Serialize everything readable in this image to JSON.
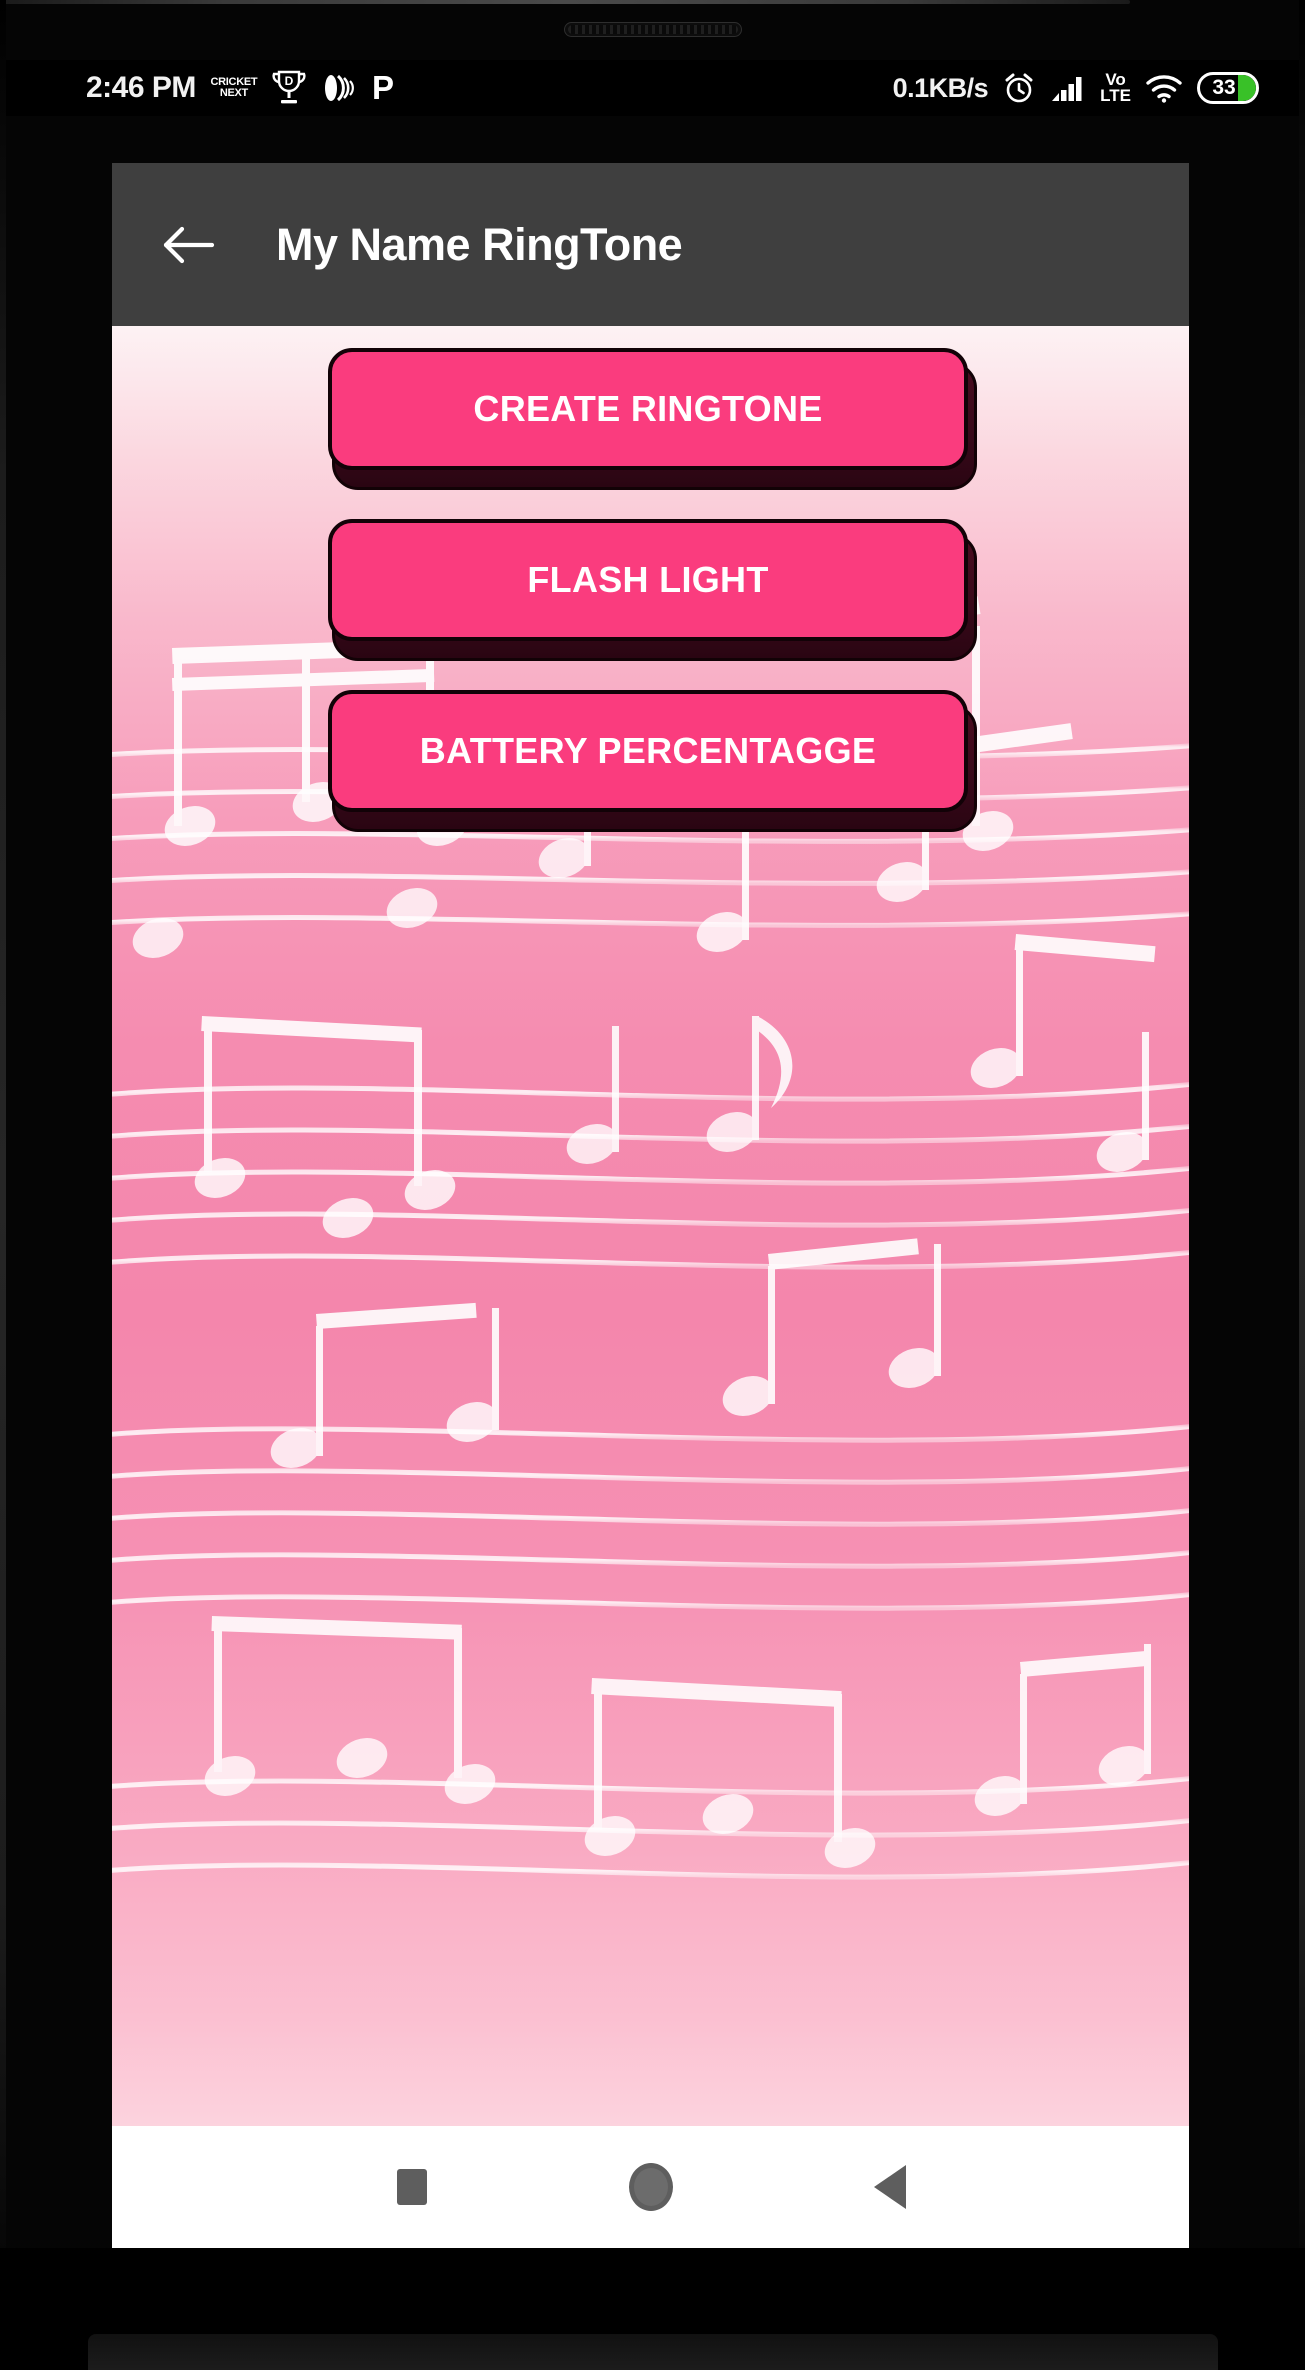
{
  "device": {
    "earpiece_icon": "speaker-grille-icon"
  },
  "status_bar": {
    "clock": "2:46 PM",
    "network_speed": "0.1KB/s",
    "battery_percent": "33",
    "battery_level_pct": 33,
    "network_label_top": "Vo",
    "network_label_bottom": "LTE",
    "notification_icons": [
      {
        "name": "cricket-next-icon",
        "line1": "CRICKET",
        "line2": "NEXT"
      },
      {
        "name": "trophy-d-icon",
        "label": "D"
      },
      {
        "name": "sound-waves-icon",
        "label": ""
      },
      {
        "name": "p-app-icon",
        "label": "P"
      }
    ],
    "right_icons": [
      {
        "name": "alarm-clock-icon"
      },
      {
        "name": "signal-bars-icon"
      },
      {
        "name": "volte-icon"
      },
      {
        "name": "wifi-icon"
      },
      {
        "name": "battery-icon"
      }
    ]
  },
  "app_bar": {
    "back_icon": "back-arrow-icon",
    "title": "My Name RingTone",
    "background_color": "#3f3f3f"
  },
  "main": {
    "background_theme": "pink-music-notes",
    "accent_color": "#fa3c7e",
    "buttons": [
      {
        "name": "create-ringtone-button",
        "label": "CREATE RINGTONE"
      },
      {
        "name": "flash-light-button",
        "label": "FLASH LIGHT"
      },
      {
        "name": "battery-percentage-button",
        "label": "BATTERY PERCENTAGGE"
      }
    ]
  },
  "nav_bar": {
    "items": [
      {
        "name": "nav-recents-button",
        "icon": "square-icon"
      },
      {
        "name": "nav-home-button",
        "icon": "circle-icon"
      },
      {
        "name": "nav-back-button",
        "icon": "triangle-left-icon"
      }
    ]
  }
}
